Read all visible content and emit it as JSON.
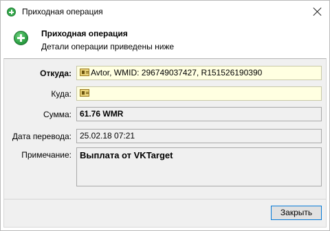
{
  "window": {
    "title": "Приходная операция"
  },
  "header": {
    "title": "Приходная операция",
    "subtitle": "Детали операции приведены ниже",
    "icon": "add-green-icon"
  },
  "form": {
    "from": {
      "label": "Откуда:",
      "value": "Avtor, WMID: 296749037427, R151526190390"
    },
    "to": {
      "label": "Куда:",
      "value": ""
    },
    "amount": {
      "label": "Сумма:",
      "value": "61.76 WMR"
    },
    "date": {
      "label": "Дата перевода:",
      "value": "25.02.18 07:21"
    },
    "note": {
      "label": "Примечание:",
      "value": "Выплата от VKTarget"
    }
  },
  "footer": {
    "close_label": "Закрыть"
  },
  "colors": {
    "accent": "#0078d7",
    "field_yellow": "#ffffe1",
    "panel_bg": "#f0f0f0",
    "icon_green": "#2ea145"
  }
}
